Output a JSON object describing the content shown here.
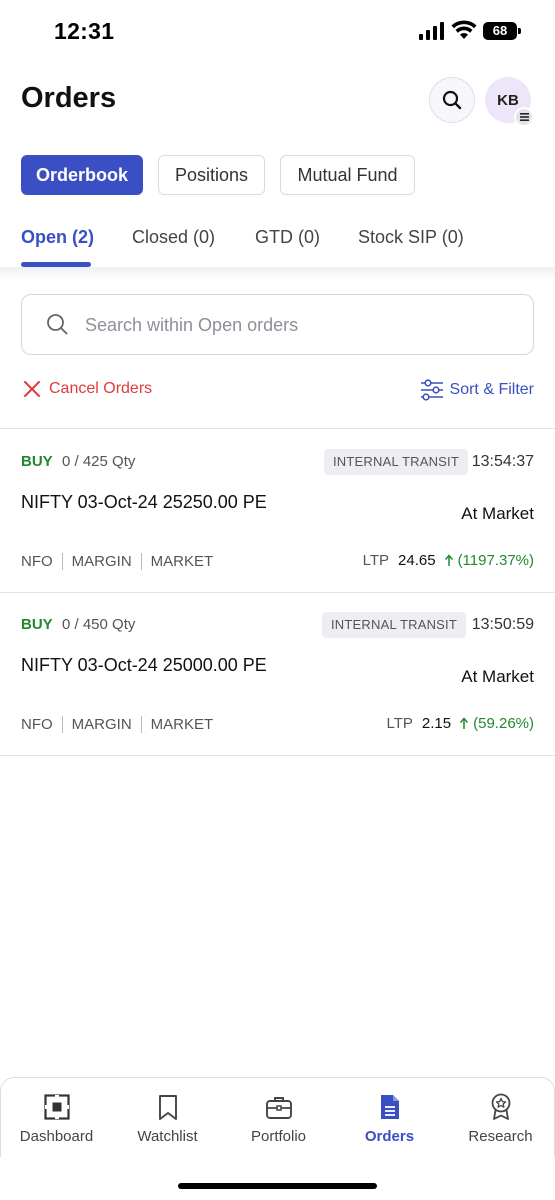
{
  "status_bar": {
    "time": "12:31",
    "battery": "68"
  },
  "header": {
    "title": "Orders",
    "avatar_initials": "KB"
  },
  "segments": {
    "orderbook": "Orderbook",
    "positions": "Positions",
    "mutual_fund": "Mutual Fund"
  },
  "subtabs": {
    "open": "Open (2)",
    "closed": "Closed (0)",
    "gtd": "GTD (0)",
    "stock_sip": "Stock SIP (0)"
  },
  "search": {
    "placeholder": "Search within Open orders"
  },
  "actions": {
    "cancel_orders": "Cancel Orders",
    "sort_filter": "Sort & Filter"
  },
  "orders": [
    {
      "side": "BUY",
      "qty": "0 / 425 Qty",
      "status": "INTERNAL TRANSIT",
      "time": "13:54:37",
      "name": "NIFTY 03-Oct-24 25250.00 PE",
      "order_type": "At Market",
      "exchange": "NFO",
      "product": "MARGIN",
      "price_type": "MARKET",
      "ltp_label": "LTP",
      "ltp": "24.65",
      "change": "(1197.37%)"
    },
    {
      "side": "BUY",
      "qty": "0 / 450 Qty",
      "status": "INTERNAL TRANSIT",
      "time": "13:50:59",
      "name": "NIFTY 03-Oct-24 25000.00 PE",
      "order_type": "At Market",
      "exchange": "NFO",
      "product": "MARGIN",
      "price_type": "MARKET",
      "ltp_label": "LTP",
      "ltp": "2.15",
      "change": "(59.26%)"
    }
  ],
  "bottom_nav": {
    "dashboard": "Dashboard",
    "watchlist": "Watchlist",
    "portfolio": "Portfolio",
    "orders": "Orders",
    "research": "Research"
  },
  "colors": {
    "accent": "#3b4fc4",
    "buy": "#1f8a2e",
    "cancel": "#e03a3a"
  }
}
